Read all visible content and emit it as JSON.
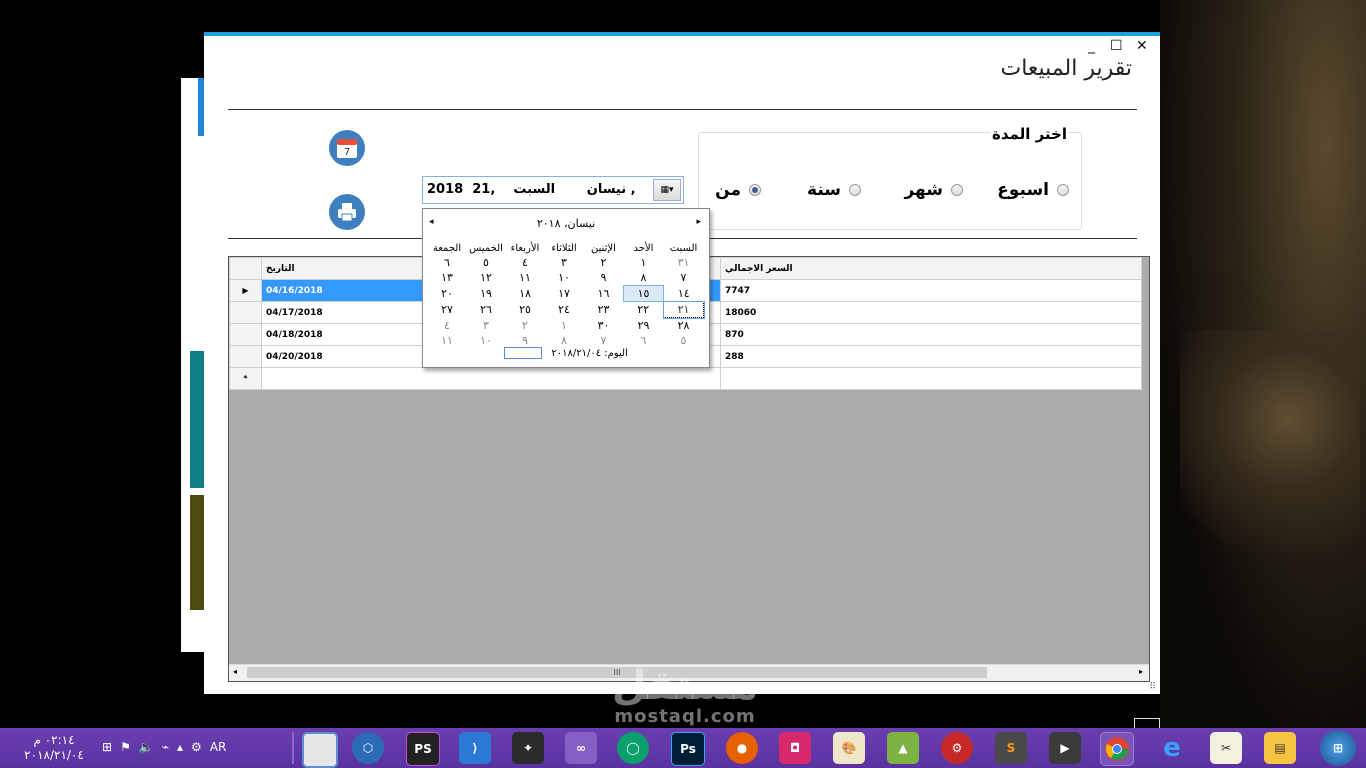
{
  "window": {
    "title": "تقرير المبيعات",
    "controls": {
      "minimize": "_",
      "maximize": "☐",
      "close": "✕"
    }
  },
  "period_group": {
    "title": "اختر المدة",
    "options": [
      {
        "label": "اسبوع",
        "selected": false
      },
      {
        "label": "شهر",
        "selected": false
      },
      {
        "label": "سنة",
        "selected": false
      },
      {
        "label": "من",
        "selected": true
      }
    ]
  },
  "date_picker": {
    "value_year": "2018",
    "value_day": "21,",
    "value_month": "نيسان",
    "value_weekday": "السبت ,"
  },
  "calendar": {
    "header": "نيسان، ٢٠١٨",
    "weekdays": [
      "السبت",
      "الأحد",
      "الإثنين",
      "الثلاثاء",
      "الأربعاء",
      "الخميس",
      "الجمعة"
    ],
    "weeks": [
      [
        "٣١",
        "١",
        "٢",
        "٣",
        "٤",
        "٥",
        "٦"
      ],
      [
        "٧",
        "٨",
        "٩",
        "١٠",
        "١١",
        "١٢",
        "١٣"
      ],
      [
        "١٤",
        "١٥",
        "١٦",
        "١٧",
        "١٨",
        "١٩",
        "٢٠"
      ],
      [
        "٢١",
        "٢٢",
        "٢٣",
        "٢٤",
        "٢٥",
        "٢٦",
        "٢٧"
      ],
      [
        "٢٨",
        "٢٩",
        "٣٠",
        "١",
        "٢",
        "٣",
        "٤"
      ],
      [
        "٥",
        "٦",
        "٧",
        "٨",
        "٩",
        "١٠",
        "١١"
      ]
    ],
    "today_label": "اليوم: ٢٠١٨/٢١/٠٤"
  },
  "icons": {
    "calendar_day": "7"
  },
  "grid": {
    "columns": [
      "التاريخ",
      "السعر الاجمالي"
    ],
    "rows": [
      {
        "date": "04/16/2018",
        "total": "7747"
      },
      {
        "date": "04/17/2018",
        "total": "18060"
      },
      {
        "date": "04/18/2018",
        "total": "870"
      },
      {
        "date": "04/20/2018",
        "total": "288"
      }
    ],
    "current_row_marker": "▶",
    "new_row_marker": "*",
    "scroll_thumb": "III"
  },
  "watermark": {
    "text": "مستقل",
    "sub": "mostaql.com"
  },
  "taskbar": {
    "time": "٠٢:١٤ م",
    "date": "٢٠١٨/٢١/٠٤",
    "language": "AR",
    "apps": [
      "Window",
      "Kubernetes",
      "PhpStorm",
      "VS Code",
      "Android Robot",
      "Visual Studio",
      "Edge Circle",
      "Photoshop",
      "Firefox",
      "Security Shield",
      "Paint",
      "Android Studio",
      "Chrome Ext",
      "Sublime Text",
      "Camtasia",
      "Chrome",
      "Internet Explorer",
      "Tools",
      "File Explorer",
      "Start"
    ],
    "tray_icons": [
      "network-icon",
      "volume-icon",
      "power-icon",
      "flag-icon",
      "ime-icon"
    ]
  }
}
